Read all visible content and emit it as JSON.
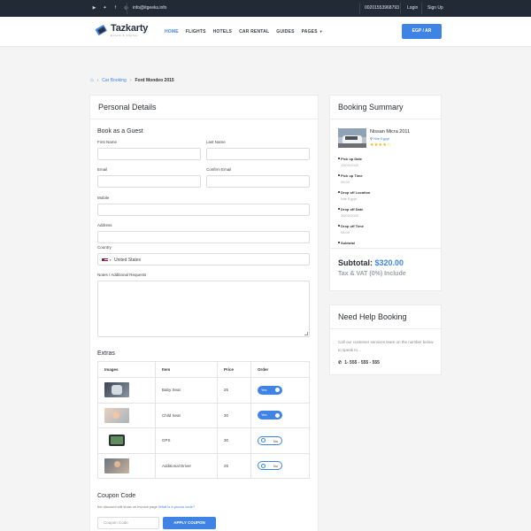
{
  "topbar": {
    "email": "info@itgeeks.info",
    "phone": "00201553968793",
    "login": "Login",
    "signup": "Sign Up",
    "social": [
      "youtube-icon",
      "twitter-icon",
      "facebook-icon",
      "instagram-icon"
    ]
  },
  "nav": {
    "logo_title": "Tazkarty",
    "logo_sub": "Hotels & Flights",
    "items": [
      "HOME",
      "FLIGHTS",
      "HOTELS",
      "CAR RENTAL",
      "GUIDES",
      "PAGES"
    ],
    "active": "HOME",
    "lang_button": "EGP / AR"
  },
  "breadcrumb": {
    "link": "Car Booking",
    "current": "Ford Mondeo 2015"
  },
  "personal": {
    "title": "Personal Details",
    "guest_title": "Book as a Guest",
    "first_name": "First Name",
    "last_name": "Last Name",
    "email": "Email",
    "confirm_email": "Confirm Email",
    "mobile": "Mobile",
    "address": "Address",
    "country": "Country",
    "country_value": "United States",
    "notes": "Notes / Additional Requests"
  },
  "extras": {
    "title": "Extras",
    "headers": [
      "Images",
      "Item",
      "Price",
      "Order"
    ],
    "rows": [
      {
        "item": "Baby Seat",
        "price": "25",
        "order": "Yes",
        "on": true
      },
      {
        "item": "Child Seat",
        "price": "30",
        "order": "Yes",
        "on": true
      },
      {
        "item": "GPS",
        "price": "30",
        "order": "No",
        "on": false
      },
      {
        "item": "Additional Driver",
        "price": "25",
        "order": "No",
        "on": false
      }
    ]
  },
  "coupon": {
    "title": "Coupon Code",
    "note": "the discount will show on invoice page",
    "link": "What is a promo code?",
    "placeholder": "Coupon Code",
    "button": "APPLY COUPON"
  },
  "summary": {
    "title": "Booking Summary",
    "car_name": "Nissan Micra 2011",
    "car_location": "Nile Egypt",
    "stars": "★★★★☆",
    "items": [
      {
        "label": "Pick up Date",
        "value": "25/03/2020"
      },
      {
        "label": "Pick up Time",
        "value": "06:00"
      },
      {
        "label": "Drop off Location",
        "value": "Nile Egypt"
      },
      {
        "label": "Drop off Date",
        "value": "26/03/2020"
      },
      {
        "label": "Drop off Time",
        "value": "06:00"
      },
      {
        "label": "Subtotal",
        "value": ""
      }
    ],
    "subtotal_label": "Subtotal:",
    "subtotal_value": "$320.00",
    "tax_note": "Tax & VAT (0%) Include"
  },
  "help": {
    "title": "Need Help Booking",
    "text": "Call our customer services team on the number below to speak to...",
    "phone": "1- 555 - 555 - 555"
  }
}
